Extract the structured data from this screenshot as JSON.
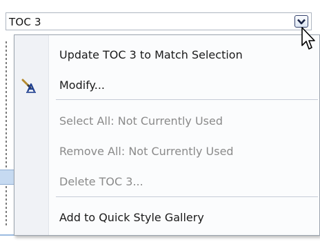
{
  "style_box": {
    "value": "TOC 3",
    "dropdown_icon": "chevron-down-icon"
  },
  "menu": {
    "items": [
      {
        "label": "Update TOC 3 to Match Selection",
        "mnemonic": "a",
        "enabled": true
      },
      {
        "label": "Modify...",
        "mnemonic": "M",
        "enabled": true,
        "icon": "modify-style-icon"
      },
      {
        "label": "Select All: Not Currently Used",
        "enabled": false
      },
      {
        "label": "Remove All: Not Currently Used",
        "enabled": false
      },
      {
        "label": "Delete TOC 3...",
        "mnemonic": "D",
        "enabled": false
      },
      {
        "label": "Add to Quick Style Gallery",
        "mnemonic": "Q",
        "enabled": true
      }
    ]
  },
  "colors": {
    "menu_bg": "#fbfcfd",
    "gutter_bg": "#f0f2f6",
    "disabled_text": "#8a8a8a",
    "enabled_text": "#1a1a1a",
    "separator": "#c5cbd6"
  }
}
